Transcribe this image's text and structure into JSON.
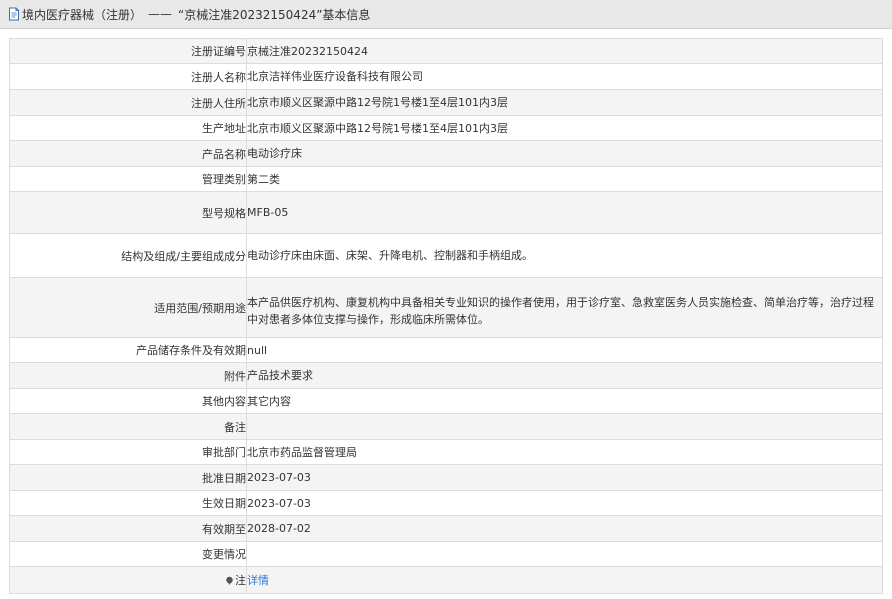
{
  "header": {
    "section": "境内医疗器械（注册）",
    "separator": "——",
    "title": "“京械注准20232150424”基本信息"
  },
  "rows": [
    {
      "label": "注册证编号",
      "value": "京械注准20232150424"
    },
    {
      "label": "注册人名称",
      "value": "北京洁祥伟业医疗设备科技有限公司"
    },
    {
      "label": "注册人住所",
      "value": "北京市顺义区聚源中路12号院1号楼1至4层101内3层"
    },
    {
      "label": "生产地址",
      "value": "北京市顺义区聚源中路12号院1号楼1至4层101内3层"
    },
    {
      "label": "产品名称",
      "value": "电动诊疗床"
    },
    {
      "label": "管理类别",
      "value": "第二类"
    },
    {
      "label": "型号规格",
      "value": "MFB-05"
    },
    {
      "label": "结构及组成/主要组成成分",
      "value": "电动诊疗床由床面、床架、升降电机、控制器和手柄组成。"
    },
    {
      "label": "适用范围/预期用途",
      "value": "本产品供医疗机构、康复机构中具备相关专业知识的操作者使用，用于诊疗室、急救室医务人员实施检查、简单治疗等，治疗过程中对患者多体位支撑与操作，形成临床所需体位。"
    },
    {
      "label": "产品储存条件及有效期",
      "value": "null"
    },
    {
      "label": "附件",
      "value": "产品技术要求"
    },
    {
      "label": "其他内容",
      "value": "其它内容"
    },
    {
      "label": "备注",
      "value": ""
    },
    {
      "label": "审批部门",
      "value": "北京市药品监督管理局"
    },
    {
      "label": "批准日期",
      "value": "2023-07-03"
    },
    {
      "label": "生效日期",
      "value": "2023-07-03"
    },
    {
      "label": "有效期至",
      "value": "2028-07-02"
    },
    {
      "label": "变更情况",
      "value": ""
    },
    {
      "label": "注",
      "value": "详情",
      "label_icon": "note-icon"
    }
  ],
  "colors": {
    "header_bg": "#e8e8e8",
    "alt_row_bg": "#f4f4f4",
    "border": "#dcdcdc",
    "link": "#2d7ad6"
  }
}
